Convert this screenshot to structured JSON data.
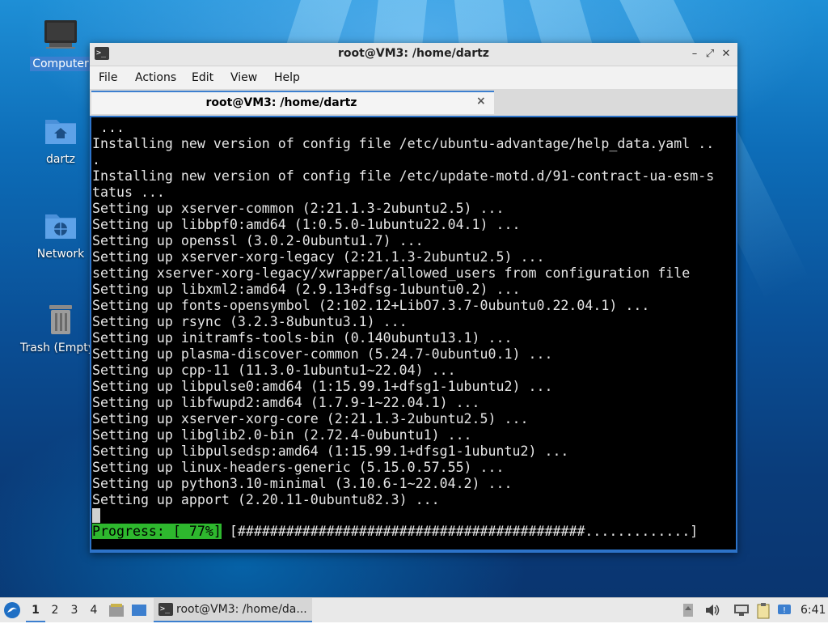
{
  "desktop": {
    "icons": [
      {
        "label": "Computer",
        "icon": "monitor-icon"
      },
      {
        "label": "dartz",
        "icon": "home-folder-icon"
      },
      {
        "label": "Network",
        "icon": "network-folder-icon"
      },
      {
        "label": "Trash (Empty)",
        "icon": "trash-icon"
      }
    ]
  },
  "window": {
    "title": "root@VM3: /home/dartz",
    "menu": [
      "File",
      "Actions",
      "Edit",
      "View",
      "Help"
    ],
    "tab_label": "root@VM3: /home/dartz",
    "tab_close": "×",
    "controls": {
      "minimize": "–",
      "maximize": "⤢",
      "close": "✕"
    }
  },
  "terminal": {
    "lines": [
      " ...",
      "Installing new version of config file /etc/ubuntu-advantage/help_data.yaml ..",
      ".",
      "Installing new version of config file /etc/update-motd.d/91-contract-ua-esm-s",
      "tatus ...",
      "Setting up xserver-common (2:21.1.3-2ubuntu2.5) ...",
      "Setting up libbpf0:amd64 (1:0.5.0-1ubuntu22.04.1) ...",
      "Setting up openssl (3.0.2-0ubuntu1.7) ...",
      "Setting up xserver-xorg-legacy (2:21.1.3-2ubuntu2.5) ...",
      "setting xserver-xorg-legacy/xwrapper/allowed_users from configuration file",
      "Setting up libxml2:amd64 (2.9.13+dfsg-1ubuntu0.2) ...",
      "Setting up fonts-opensymbol (2:102.12+LibO7.3.7-0ubuntu0.22.04.1) ...",
      "Setting up rsync (3.2.3-8ubuntu3.1) ...",
      "Setting up initramfs-tools-bin (0.140ubuntu13.1) ...",
      "Setting up plasma-discover-common (5.24.7-0ubuntu0.1) ...",
      "Setting up cpp-11 (11.3.0-1ubuntu1~22.04) ...",
      "Setting up libpulse0:amd64 (1:15.99.1+dfsg1-1ubuntu2) ...",
      "Setting up libfwupd2:amd64 (1.7.9-1~22.04.1) ...",
      "Setting up xserver-xorg-core (2:21.1.3-2ubuntu2.5) ...",
      "Setting up libglib2.0-bin (2.72.4-0ubuntu1) ...",
      "Setting up libpulsedsp:amd64 (1:15.99.1+dfsg1-1ubuntu2) ...",
      "Setting up linux-headers-generic (5.15.0.57.55) ...",
      "Setting up python3.10-minimal (3.10.6-1~22.04.2) ...",
      "Setting up apport (2.20.11-0ubuntu82.3) ..."
    ],
    "progress_label": "Progress: [ 77%]",
    "progress_bar": "[###########################################.............]",
    "progress_percent": 77
  },
  "taskbar": {
    "workspaces": [
      "1",
      "2",
      "3",
      "4"
    ],
    "active_workspace": "1",
    "task_label": "root@VM3: /home/da...",
    "clock": "6:41"
  },
  "colors": {
    "accent": "#3c7fcf",
    "progress_green": "#2eb82e",
    "terminal_bg": "#000000",
    "terminal_fg": "#e6e6e6"
  }
}
